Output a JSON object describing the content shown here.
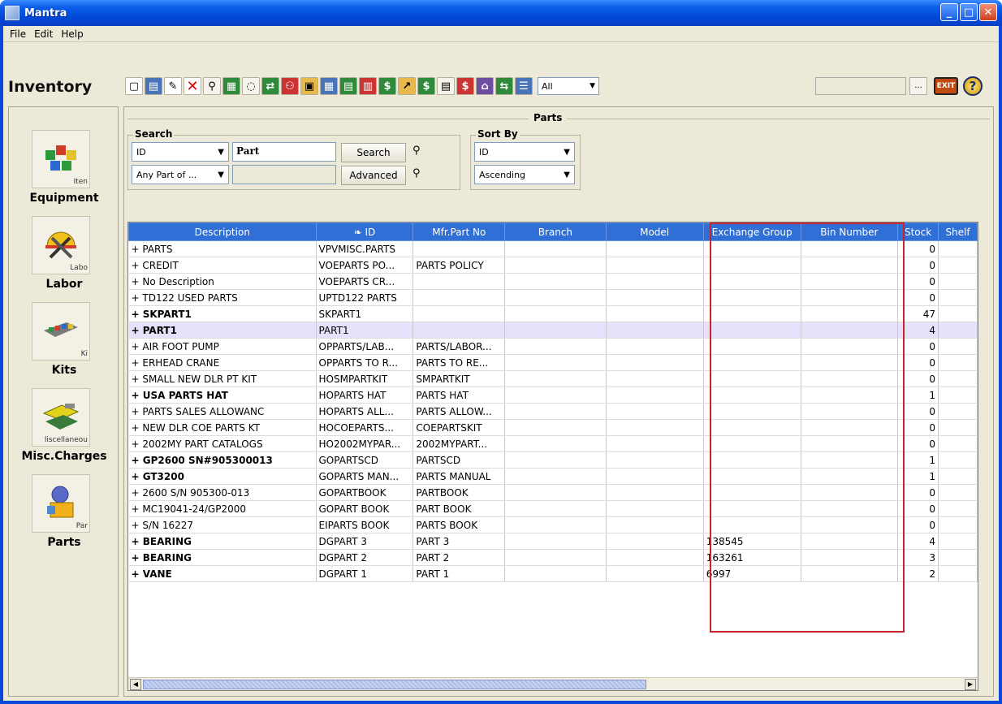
{
  "window": {
    "title": "Mantra"
  },
  "menu": [
    "File",
    "Edit",
    "Help"
  ],
  "module_title": "Inventory",
  "toolbar": {
    "filter_value": "All",
    "ellipsis": "...",
    "exit_label": "EXIT",
    "help_label": "?"
  },
  "sidebar": [
    {
      "label": "Equipment",
      "cut": "Iten"
    },
    {
      "label": "Labor",
      "cut": "Labo"
    },
    {
      "label": "Kits",
      "cut": "Ki"
    },
    {
      "label": "Misc.Charges",
      "cut": "liscellaneou"
    },
    {
      "label": "Parts",
      "cut": "Par"
    }
  ],
  "panel": {
    "title": "Parts"
  },
  "search": {
    "title": "Search",
    "field": "ID",
    "term": "Part",
    "match": "Any Part of ...",
    "search_btn": "Search",
    "advanced_btn": "Advanced"
  },
  "sort": {
    "title": "Sort By",
    "field": "ID",
    "order": "Ascending"
  },
  "table": {
    "columns": [
      "Description",
      "❧ ID",
      "Mfr.Part No",
      "Branch",
      "Model",
      "Exchange Group",
      "Bin Number",
      "Stock",
      "Shelf"
    ],
    "rows": [
      {
        "d": "+ PARTS",
        "id": "VPVMISC.PARTS",
        "m": "",
        "eg": "",
        "st": "0",
        "b": false
      },
      {
        "d": "+ CREDIT",
        "id": "VOEPARTS PO...",
        "m": "PARTS POLICY",
        "eg": "",
        "st": "0",
        "b": false
      },
      {
        "d": "+ No Description",
        "id": "VOEPARTS CR...",
        "m": "",
        "eg": "",
        "st": "0",
        "b": false
      },
      {
        "d": "+ TD122 USED PARTS",
        "id": "UPTD122 PARTS",
        "m": "",
        "eg": "",
        "st": "0",
        "b": false
      },
      {
        "d": "+ SKPART1",
        "id": "SKPART1",
        "m": "",
        "eg": "",
        "st": "47",
        "b": true
      },
      {
        "d": "+ PART1",
        "id": "PART1",
        "m": "",
        "eg": "",
        "st": "4",
        "b": true,
        "sel": true
      },
      {
        "d": "+ AIR FOOT PUMP",
        "id": "OPPARTS/LAB...",
        "m": "PARTS/LABOR...",
        "eg": "",
        "st": "0",
        "b": false
      },
      {
        "d": "+ ERHEAD CRANE",
        "id": "OPPARTS TO R...",
        "m": "PARTS TO RE...",
        "eg": "",
        "st": "0",
        "b": false
      },
      {
        "d": "+ SMALL NEW DLR PT KIT",
        "id": "HOSMPARTKIT",
        "m": "SMPARTKIT",
        "eg": "",
        "st": "0",
        "b": false
      },
      {
        "d": "+ USA PARTS HAT",
        "id": "HOPARTS HAT",
        "m": "PARTS HAT",
        "eg": "",
        "st": "1",
        "b": true
      },
      {
        "d": "+ PARTS SALES ALLOWANC",
        "id": "HOPARTS ALL...",
        "m": "PARTS ALLOW...",
        "eg": "",
        "st": "0",
        "b": false
      },
      {
        "d": "+ NEW DLR COE PARTS KT",
        "id": "HOCOEPARTS...",
        "m": "COEPARTSKIT",
        "eg": "",
        "st": "0",
        "b": false
      },
      {
        "d": "+ 2002MY PART CATALOGS",
        "id": "HO2002MYPAR...",
        "m": "2002MYPART...",
        "eg": "",
        "st": "0",
        "b": false
      },
      {
        "d": "+ GP2600 SN#905300013",
        "id": "GOPARTSCD",
        "m": "PARTSCD",
        "eg": "",
        "st": "1",
        "b": true
      },
      {
        "d": "+ GT3200",
        "id": "GOPARTS MAN...",
        "m": "PARTS MANUAL",
        "eg": "",
        "st": "1",
        "b": true
      },
      {
        "d": "+ 2600 S/N 905300-013",
        "id": "GOPARTBOOK",
        "m": "PARTBOOK",
        "eg": "",
        "st": "0",
        "b": false
      },
      {
        "d": "+ MC19041-24/GP2000",
        "id": "GOPART BOOK",
        "m": "PART BOOK",
        "eg": "",
        "st": "0",
        "b": false
      },
      {
        "d": "+ S/N 16227",
        "id": "EIPARTS BOOK",
        "m": "PARTS BOOK",
        "eg": "",
        "st": "0",
        "b": false
      },
      {
        "d": "+ BEARING",
        "id": "DGPART 3",
        "m": "PART 3",
        "eg": "138545",
        "st": "4",
        "b": true
      },
      {
        "d": "+ BEARING",
        "id": "DGPART 2",
        "m": "PART 2",
        "eg": "163261",
        "st": "3",
        "b": true
      },
      {
        "d": "+ VANE",
        "id": "DGPART 1",
        "m": "PART 1",
        "eg": "6997",
        "st": "2",
        "b": true
      }
    ]
  }
}
